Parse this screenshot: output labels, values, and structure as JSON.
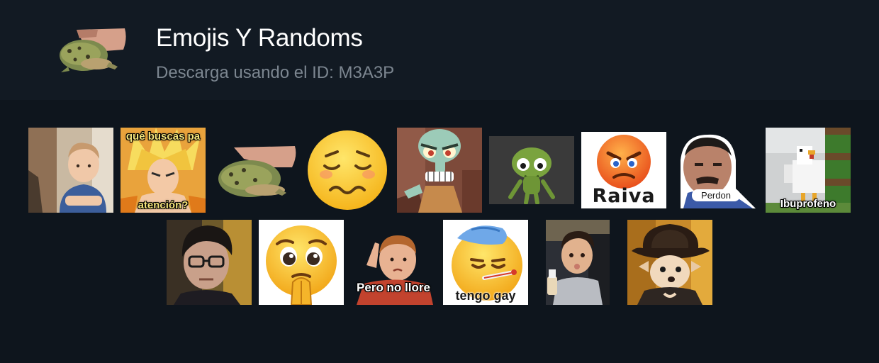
{
  "pack": {
    "title": "Emojis Y Randoms",
    "subtitle_prefix": "Descarga usando el ID:",
    "id": "M3A3P",
    "icon": "toad-in-hand-icon"
  },
  "stickers": [
    {
      "name": "sticker-toddler-crossed-arms",
      "caption": ""
    },
    {
      "name": "sticker-goku-que-buscas",
      "caption_top": "qué buscas pa",
      "caption_bottom": "atención?"
    },
    {
      "name": "sticker-toad-in-hand",
      "caption": ""
    },
    {
      "name": "sticker-woozy-face-emoji",
      "caption": ""
    },
    {
      "name": "sticker-squidward-angry",
      "caption": ""
    },
    {
      "name": "sticker-green-creature",
      "caption": ""
    },
    {
      "name": "sticker-angry-emoji-raiva",
      "caption": "Raiva"
    },
    {
      "name": "sticker-man-perdon",
      "caption": "Perdon"
    },
    {
      "name": "sticker-minecraft-chicken-ibuprofeno",
      "caption": "Ibuprofeno"
    },
    {
      "name": "sticker-boy-glasses",
      "caption": ""
    },
    {
      "name": "sticker-pleading-emoji",
      "caption": ""
    },
    {
      "name": "sticker-kid-pero-no-llore",
      "caption": "Pero no llore"
    },
    {
      "name": "sticker-sick-emoji-tengo-gay",
      "caption": "tengo gay"
    },
    {
      "name": "sticker-toddler-car-seat",
      "caption": ""
    },
    {
      "name": "sticker-chihuahua-cowboy-hat",
      "caption": ""
    }
  ]
}
